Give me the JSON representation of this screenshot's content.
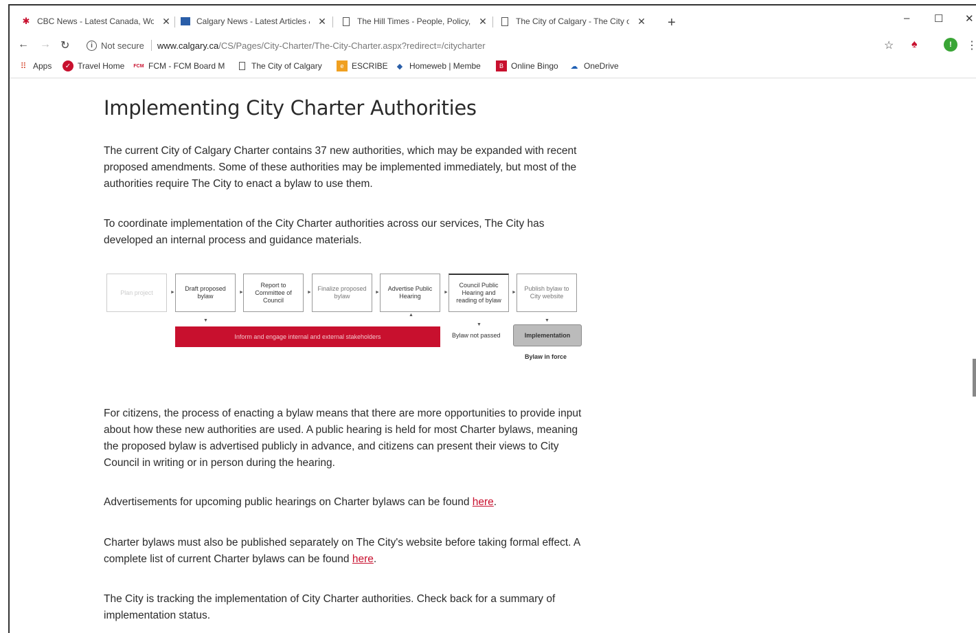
{
  "browser": {
    "tabs": [
      {
        "title": "CBC News - Latest Canada, Wo",
        "icon": "cbc-gem-icon",
        "color": "#c8102e"
      },
      {
        "title": "Calgary News - Latest Articles &",
        "icon": "calgary-news-icon",
        "color": "#2a5ea8"
      },
      {
        "title": "The Hill Times - People, Policy, I",
        "icon": "page-icon",
        "color": "#555555"
      },
      {
        "title": "The City of Calgary - The City of",
        "icon": "page-icon",
        "color": "#555555"
      }
    ],
    "new_tab": "+",
    "window_controls": {
      "minimize": "–",
      "maximize": "☐",
      "close": "✕"
    }
  },
  "toolbar": {
    "security_label": "Not secure",
    "url_host": "www.calgary.ca",
    "url_path": "/CS/Pages/City-Charter/The-City-Charter.aspx?redirect=/citycharter",
    "extension_badge": "!"
  },
  "bookmarks": [
    {
      "label": "Apps",
      "icon": "apps-grid-icon"
    },
    {
      "label": "Travel Home",
      "icon": "travel-icon"
    },
    {
      "label": "FCM - FCM Board M",
      "icon": "fcm-icon"
    },
    {
      "label": "The City of Calgary",
      "icon": "page-icon"
    },
    {
      "label": "ESCRIBE",
      "icon": "escribe-icon"
    },
    {
      "label": "Homeweb | Membe",
      "icon": "homeweb-icon"
    },
    {
      "label": "Online Bingo",
      "icon": "bingo-icon"
    },
    {
      "label": "OneDrive",
      "icon": "onedrive-icon"
    }
  ],
  "page": {
    "title": "Implementing City Charter Authorities",
    "intro": "The current City of Calgary Charter contains 37 new authorities, which may be expanded with recent proposed amendments. Some of these authorities may be implemented immediately, but most of the authorities require The City to enact a bylaw to use them.",
    "coordinate": "To coordinate implementation of the City Charter authorities across our services, The City has developed an internal process and guidance materials.",
    "citizens": "For citizens, the process of enacting a bylaw means that there are more opportunities to provide input about how these new authorities are used. A public hearing is held for most Charter bylaws, meaning the proposed bylaw is advertised publicly in advance, and citizens can present their views to City Council in writing or in person during the hearing.",
    "ads_text": "Advertisements for upcoming public hearings on Charter bylaws can be found ",
    "ads_link": "here",
    "publish_text": "Charter bylaws must also be published separately on The City's website before taking formal effect. A complete list of current Charter bylaws can be found ",
    "publish_link": "here",
    "tracking": "The City is tracking the implementation of City Charter authorities. Check back for a summary of implementation status."
  },
  "diagram": {
    "steps": [
      "Plan project",
      "Draft proposed bylaw",
      "Report to Committee of Council",
      "Finalize proposed bylaw",
      "Advertise Public Hearing",
      "Council Public Hearing and reading of bylaw",
      "Publish bylaw to City website"
    ],
    "red_bar": "Inform and engage internal and external stakeholders",
    "not_passed": "Bylaw not passed",
    "implementation": "Implementation",
    "in_force": "Bylaw in force"
  }
}
